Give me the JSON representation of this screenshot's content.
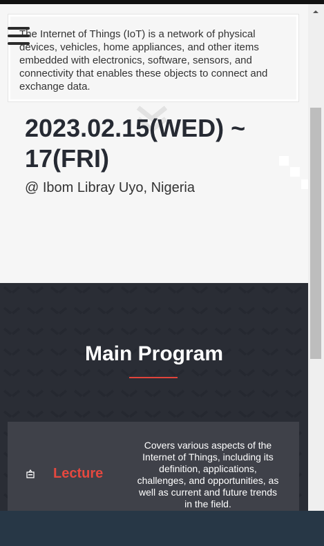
{
  "intro": {
    "text": "The Internet of Things (IoT) is a network of physical devices, vehicles, home appliances, and other items embedded with electronics, software, sensors, and connectivity that enables these objects to connect and exchange data."
  },
  "menu": {
    "icon": "hamburger-menu-icon"
  },
  "event": {
    "date": "2023.02.15(WED) ~ 17(FRI)",
    "location": "@ Ibom Libray Uyo, Nigeria"
  },
  "program": {
    "title": "Main Program",
    "accent": "#e2443b",
    "cards": [
      {
        "icon": "presentation-icon",
        "title": "Lecture",
        "description": "Covers various aspects of the Internet of Things, including its definition, applications, challenges, and opportunities, as well as current and future trends in the field."
      }
    ]
  },
  "colors": {
    "dark_section": "#2a2d35",
    "card": "#3f4149",
    "footer": "#273746"
  }
}
